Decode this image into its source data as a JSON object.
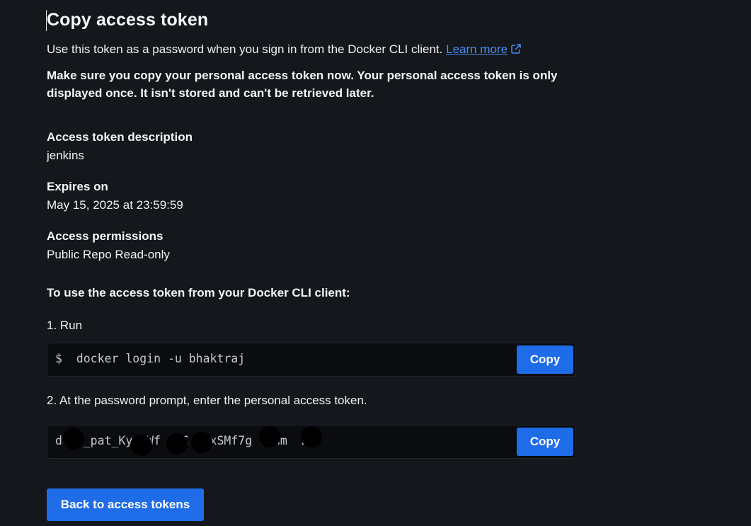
{
  "page": {
    "title": "Copy access token",
    "intro_text": "Use this token as a password when you sign in from the Docker CLI client.",
    "learn_more_label": "Learn more",
    "warning": "Make sure you copy your personal access token now. Your personal access token is only displayed once. It isn't stored and can't be retrieved later."
  },
  "details": {
    "description": {
      "label": "Access token description",
      "value": "jenkins"
    },
    "expires": {
      "label": "Expires on",
      "value": "May 15, 2025 at 23:59:59"
    },
    "permissions": {
      "label": "Access permissions",
      "value": "Public Repo Read-only"
    }
  },
  "cli": {
    "heading": "To use the access token from your Docker CLI client:",
    "step1": "1. Run",
    "command": "$  docker login -u bhaktraj",
    "step2": "2. At the password prompt, enter the personal access token.",
    "token": "dckr_pat_Ky  Wf   C  -xSMf7g  Phm  B",
    "copy_label": "Copy"
  },
  "footer": {
    "back_label": "Back to access tokens"
  },
  "colors": {
    "background": "#14171c",
    "accent": "#1f6ce8",
    "link": "#4a8df2"
  }
}
